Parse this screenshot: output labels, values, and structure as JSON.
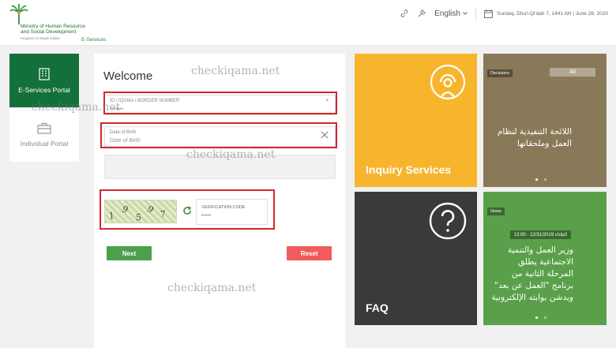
{
  "header": {
    "ministry_line1": "Ministry of Human Resource",
    "ministry_line2": "and Social Development",
    "kingdom": "Kingdom of Saudi Arabia",
    "eservices": "E-Services",
    "language": "English",
    "date": "Sunday, Dhu'l-Qi'dah 7, 1441 AH | June 28, 2020"
  },
  "nav": {
    "eservices_portal": "E-Services Portal",
    "individual_portal": "Individual Portal"
  },
  "form": {
    "title": "Welcome",
    "id_label": "ID / IQAMA / BORDER NUMBER",
    "id_value": "•••••••",
    "required_mark": "*",
    "dob_label": "Date of Birth",
    "dob_placeholder": "Date of Birth",
    "captcha_chars": [
      "1",
      "9",
      "5",
      "9",
      "7"
    ],
    "verification_label": "VERIFICATION CODE",
    "verification_value": "•••••",
    "next_label": "Next",
    "reset_label": "Reset"
  },
  "tiles": {
    "inquiry_title": "Inquiry Services",
    "faq_title": "FAQ",
    "decisions_tag": "Decisions",
    "decisions_all": "All",
    "decisions_text": "اللائحة التنفيذية لنظام العمل وملحقاتها",
    "news_tag": "News",
    "news_date": "الثلاثاء 12/31/2019 - 12:00",
    "news_text": "وزير العمل والتنمية الاجتماعية يطلق المرحلة الثانية من برنامج \"العمل عن بعد\" ويدشن بوابته الإلكترونية"
  },
  "watermark": "checkiqama.net",
  "colors": {
    "brand_green": "#13703a",
    "inquiry": "#f7b52d",
    "decisions": "#8a7959",
    "faq": "#3a3a3a",
    "news": "#5aa04a",
    "highlight": "#d62728"
  }
}
